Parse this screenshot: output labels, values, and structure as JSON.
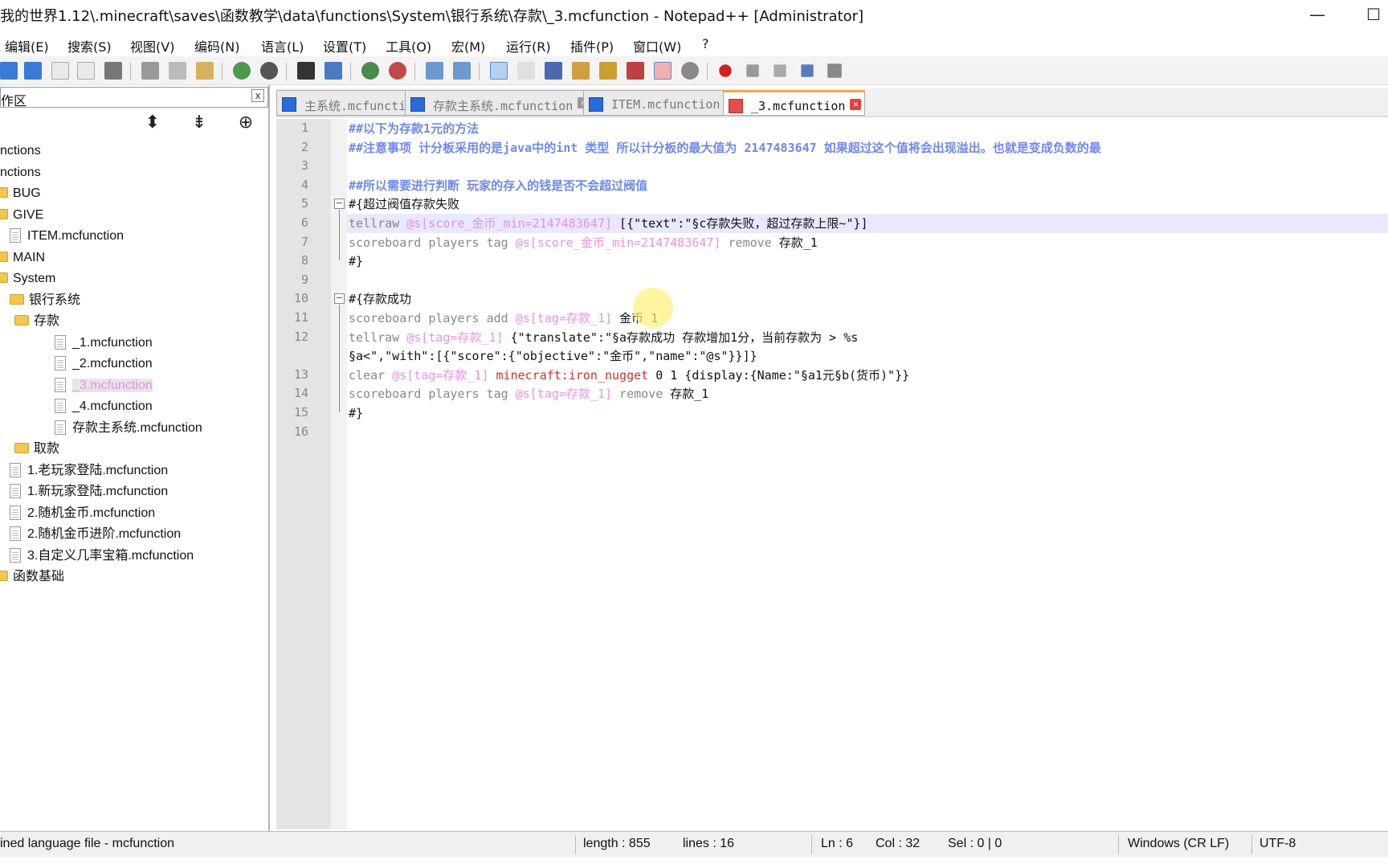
{
  "window": {
    "title": "我的世界1.12\\.minecraft\\saves\\函数教学\\data\\functions\\System\\银行系统\\存款\\_3.mcfunction - Notepad++ [Administrator]",
    "minimize": "—",
    "maximize": "☐"
  },
  "menu": [
    "编辑(E)",
    "搜索(S)",
    "视图(V)",
    "编码(N)",
    "语言(L)",
    "设置(T)",
    "工具(O)",
    "宏(M)",
    "运行(R)",
    "插件(P)",
    "窗口(W)",
    "?"
  ],
  "panel": {
    "title": "作区",
    "close": "x",
    "tools": [
      "⬍",
      "⇟",
      "⊕"
    ],
    "tree": [
      {
        "label": "nctions",
        "indent": 0,
        "kind": "none"
      },
      {
        "label": "nctions",
        "indent": 0,
        "kind": "none"
      },
      {
        "label": "BUG",
        "indent": 0,
        "kind": "folder"
      },
      {
        "label": "GIVE",
        "indent": 0,
        "kind": "folder"
      },
      {
        "label": "ITEM.mcfunction",
        "indent": 1,
        "kind": "file"
      },
      {
        "label": "MAIN",
        "indent": 0,
        "kind": "folder"
      },
      {
        "label": "System",
        "indent": 0,
        "kind": "folder"
      },
      {
        "label": "银行系统",
        "indent": 1,
        "kind": "folder"
      },
      {
        "label": "存款",
        "indent": 2,
        "kind": "folder"
      },
      {
        "label": "_1.mcfunction",
        "indent": 3,
        "kind": "file"
      },
      {
        "label": "_2.mcfunction",
        "indent": 3,
        "kind": "file"
      },
      {
        "label": "_3.mcfunction",
        "indent": 3,
        "kind": "file",
        "selected": true
      },
      {
        "label": "_4.mcfunction",
        "indent": 3,
        "kind": "file"
      },
      {
        "label": "存款主系统.mcfunction",
        "indent": 3,
        "kind": "file"
      },
      {
        "label": "取款",
        "indent": 2,
        "kind": "folder"
      },
      {
        "label": "1.老玩家登陆.mcfunction",
        "indent": 1,
        "kind": "file"
      },
      {
        "label": "1.新玩家登陆.mcfunction",
        "indent": 1,
        "kind": "file"
      },
      {
        "label": "2.随机金币.mcfunction",
        "indent": 1,
        "kind": "file"
      },
      {
        "label": "2.随机金币进阶.mcfunction",
        "indent": 1,
        "kind": "file"
      },
      {
        "label": "3.自定义几率宝箱.mcfunction",
        "indent": 1,
        "kind": "file"
      },
      {
        "label": "函数基础",
        "indent": 0,
        "kind": "folder"
      }
    ]
  },
  "tabs": [
    {
      "label": "主系统.mcfunction",
      "close": "✕"
    },
    {
      "label": "存款主系统.mcfunction",
      "close": "✕"
    },
    {
      "label": "ITEM.mcfunction",
      "close": "✕"
    },
    {
      "label": "_3.mcfunction",
      "close": "✕",
      "active": true
    }
  ],
  "editor": {
    "line_numbers": [
      "1",
      "2",
      "3",
      "4",
      "5",
      "6",
      "7",
      "8",
      "9",
      "10",
      "11",
      "12",
      "",
      "13",
      "14",
      "15",
      "16"
    ],
    "lines": [
      [
        {
          "t": "##以下为存款1元的方法",
          "c": "c"
        }
      ],
      [
        {
          "t": "##注意事项 计分板采用的是java中的int 类型 所以计分板的最大值为 2147483647 如果超过这个值将会出现溢出。也就是变成负数的最",
          "c": "c"
        }
      ],
      [],
      [
        {
          "t": "##所以需要进行判断 玩家的存入的钱是否不会超过阀值",
          "c": "c"
        }
      ],
      [
        {
          "t": "#{超过阀值存款失败",
          "c": ""
        }
      ],
      [
        {
          "t": "tellraw ",
          "c": "kw"
        },
        {
          "t": "@s[score_金币_min=2147483647]",
          "c": "sel"
        },
        {
          "t": " [{\"text\":\"§c存款失败，超过存款上限~\"}]",
          "c": ""
        }
      ],
      [
        {
          "t": "scoreboard players tag ",
          "c": "kw"
        },
        {
          "t": "@s[score_金币_min=2147483647]",
          "c": "sel"
        },
        {
          "t": " remove ",
          "c": "kw"
        },
        {
          "t": "存款_1",
          "c": ""
        }
      ],
      [
        {
          "t": "#}",
          "c": ""
        }
      ],
      [],
      [
        {
          "t": "#{存款成功",
          "c": ""
        }
      ],
      [
        {
          "t": "scoreboard players add ",
          "c": "kw"
        },
        {
          "t": "@s[tag=存款_1]",
          "c": "sel"
        },
        {
          "t": " 金币 1",
          "c": ""
        }
      ],
      [
        {
          "t": "tellraw ",
          "c": "kw"
        },
        {
          "t": "@s[tag=存款_1]",
          "c": "sel"
        },
        {
          "t": " {\"translate\":\"§a存款成功 存款增加1分，当前存款为 > %s",
          "c": ""
        }
      ],
      [
        {
          "t": "§a<\",\"with\":[{\"score\":{\"objective\":\"金币\",\"name\":\"@s\"}}]}",
          "c": ""
        }
      ],
      [
        {
          "t": "clear ",
          "c": "kw"
        },
        {
          "t": "@s[tag=存款_1]",
          "c": "sel"
        },
        {
          "t": " minecraft:iron_nugget",
          "c": "mc"
        },
        {
          "t": " 0 1 {display:{Name:\"§a1元§b(货币)\"}}",
          "c": ""
        }
      ],
      [
        {
          "t": "scoreboard players tag ",
          "c": "kw"
        },
        {
          "t": "@s[tag=存款_1]",
          "c": "sel"
        },
        {
          "t": " remove ",
          "c": "kw"
        },
        {
          "t": "存款_1",
          "c": ""
        }
      ],
      [
        {
          "t": "#}",
          "c": ""
        }
      ],
      []
    ]
  },
  "status": {
    "language": "ined language file - mcfunction",
    "length": "length : 855",
    "lines": "lines : 16",
    "ln": "Ln : 6",
    "col": "Col : 32",
    "sel": "Sel : 0 | 0",
    "eol": "Windows (CR LF)",
    "encoding": "UTF-8"
  }
}
